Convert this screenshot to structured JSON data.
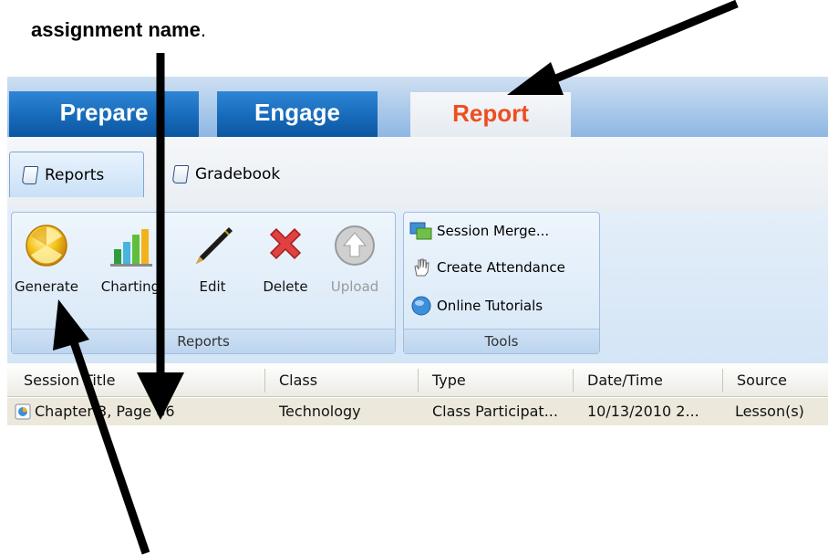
{
  "caption": {
    "text": "assignment name",
    "suffix": "."
  },
  "main_tabs": {
    "prepare": "Prepare",
    "engage": "Engage",
    "report": "Report"
  },
  "sub_tabs": {
    "reports": "Reports",
    "gradebook": "Gradebook"
  },
  "ribbon": {
    "reports_group": {
      "label": "Reports",
      "buttons": {
        "generate": "Generate",
        "charting": "Charting",
        "edit": "Edit",
        "delete": "Delete",
        "upload": "Upload"
      }
    },
    "tools_group": {
      "label": "Tools",
      "items": {
        "session_merge": "Session Merge...",
        "create_attendance": "Create Attendance",
        "online_tutorials": "Online Tutorials"
      }
    }
  },
  "list": {
    "columns": [
      "Session Title",
      "Class",
      "Type",
      "Date/Time",
      "Source"
    ],
    "rows": [
      [
        "Chapter 3, Page 86",
        "Technology",
        "Class Participat...",
        "10/13/2010 2...",
        "Lesson(s)"
      ]
    ]
  },
  "colors": {
    "active_tab_text": "#ee4e1e",
    "main_tab_blue": "#1568b8"
  }
}
